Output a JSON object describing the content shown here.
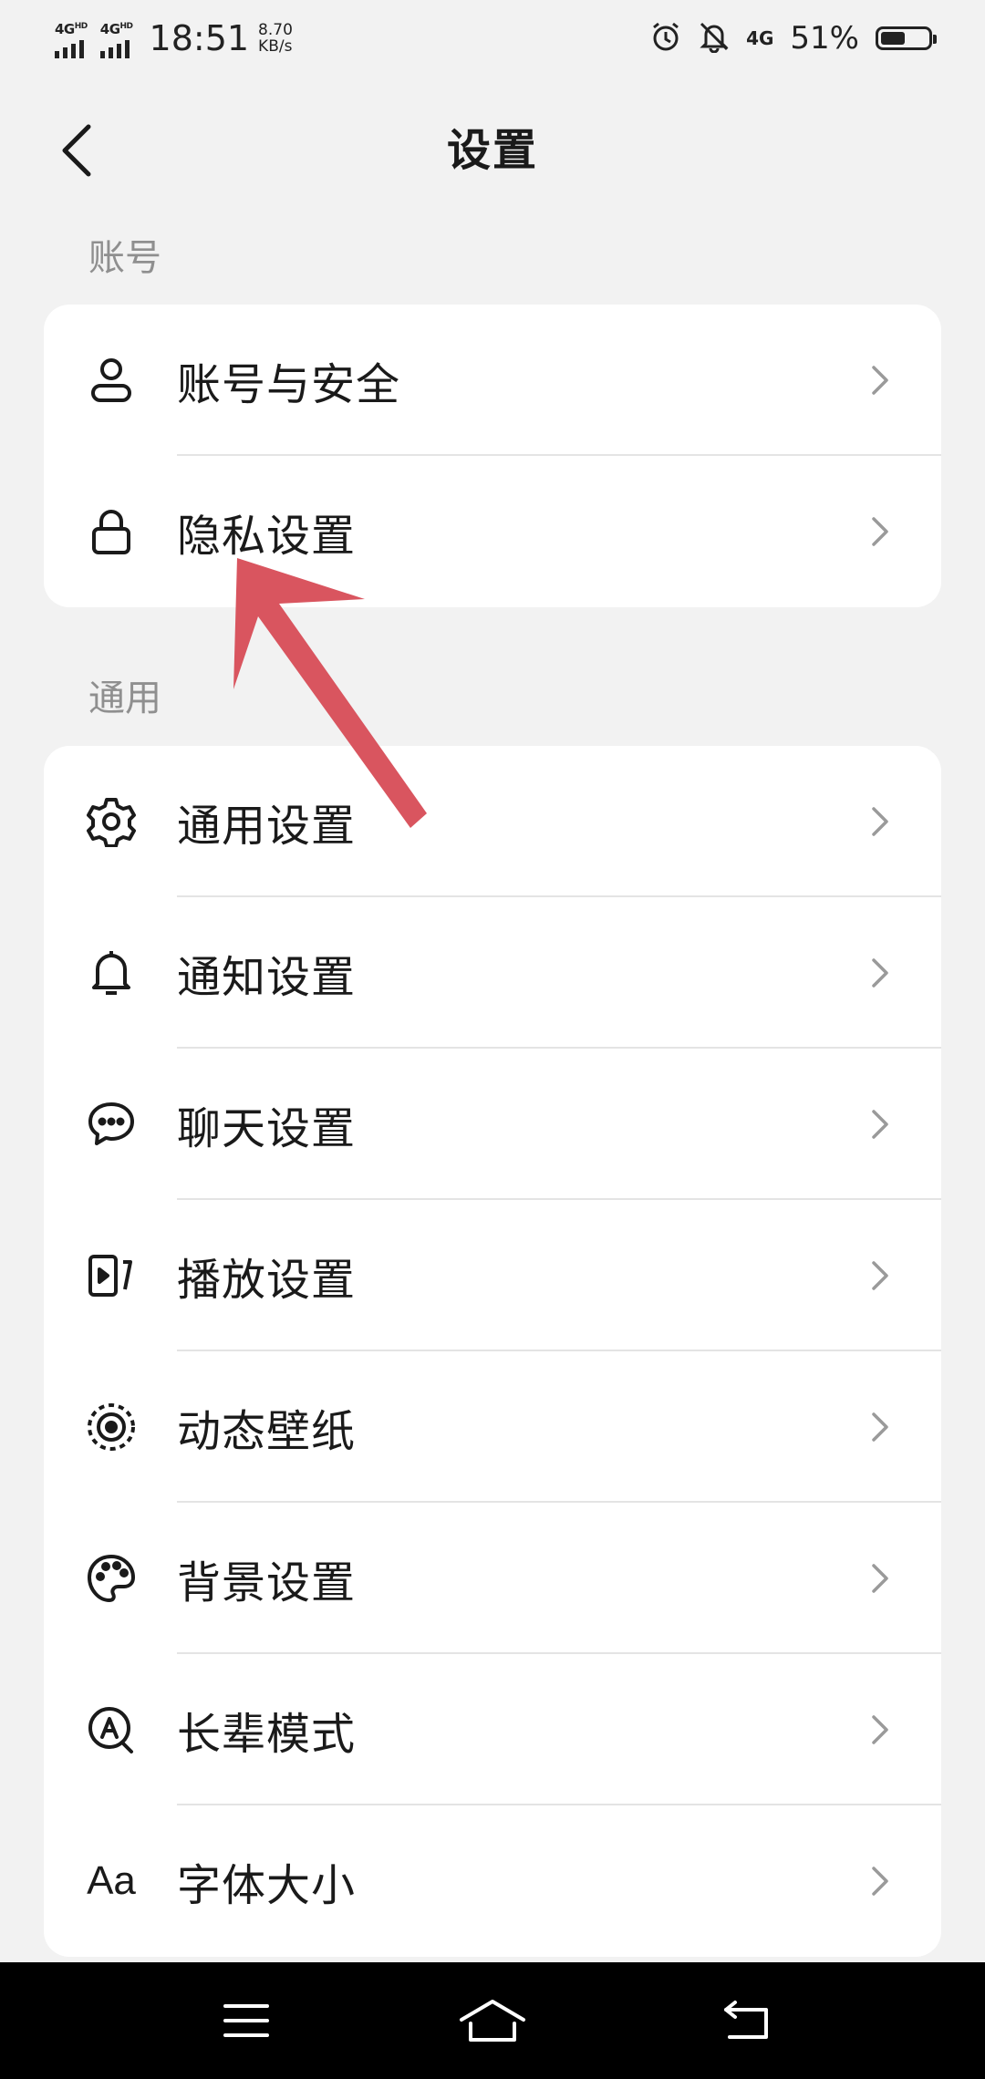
{
  "status_bar": {
    "sim1": "4G",
    "sim1_sup": "HD",
    "sim2": "4G",
    "sim2_sup": "HD",
    "time": "18:51",
    "net_speed_value": "8.70",
    "net_speed_unit": "KB/s",
    "network_type": "4G",
    "battery_percent_text": "51%",
    "battery_level": 0.51
  },
  "header": {
    "title": "设置"
  },
  "sections": {
    "account": {
      "title": "账号",
      "items": [
        {
          "label": "账号与安全",
          "icon": "person-icon"
        },
        {
          "label": "隐私设置",
          "icon": "lock-icon"
        }
      ]
    },
    "general": {
      "title": "通用",
      "items": [
        {
          "label": "通用设置",
          "icon": "gear-icon"
        },
        {
          "label": "通知设置",
          "icon": "bell-icon"
        },
        {
          "label": "聊天设置",
          "icon": "chat-bubble-icon"
        },
        {
          "label": "播放设置",
          "icon": "play-video-icon"
        },
        {
          "label": "动态壁纸",
          "icon": "live-wallpaper-icon"
        },
        {
          "label": "背景设置",
          "icon": "palette-icon"
        },
        {
          "label": "长辈模式",
          "icon": "elder-mode-icon"
        },
        {
          "label": "字体大小",
          "icon": "font-size-icon",
          "icon_text": "Aa"
        }
      ]
    }
  },
  "colors": {
    "background": "#f2f2f2",
    "card": "#ffffff",
    "annotation_arrow": "#d9555f",
    "navbar": "#000000"
  },
  "nav_bar": {
    "buttons": [
      "menu-icon",
      "home-icon",
      "back-icon"
    ]
  }
}
